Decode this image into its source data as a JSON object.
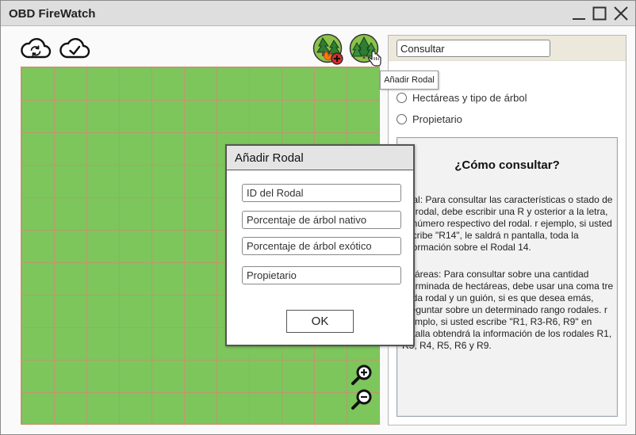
{
  "window": {
    "title": "OBD FireWatch"
  },
  "toolbar": {
    "sync_icon": "cloud-sync-icon",
    "saved_icon": "cloud-check-icon",
    "add_fire_icon": "tree-fire-add-icon",
    "add_stand_icon": "forest-add-icon",
    "tooltip": "Añadir Rodal"
  },
  "map": {
    "zoom_in_icon": "zoom-in-icon",
    "zoom_out_icon": "zoom-out-icon",
    "fill_color": "#7cc65c",
    "grid_color": "#c49470"
  },
  "panel": {
    "search_value": "Consultar",
    "options": [
      {
        "label": "Hectáreas y tipo de árbol"
      },
      {
        "label": "Propietario"
      }
    ],
    "help": {
      "title": "¿Cómo consultar?",
      "para1": "odal: Para consultar las características o stado de un rodal, debe escribir una R y osterior a la letra, el número respectivo del rodal. r ejemplo, si usted escribe \"R14\", le saldrá n pantalla, toda la información sobre el Rodal 14.",
      "para2": "ectáreas: Para consultar sobre una cantidad eterminada de hectáreas, debe usar una coma tre cada rodal y un guión, si es que desea emás, preguntar sobre un determinado rango rodales. r ejemplo, si usted escribe  \"R1, R3-R6, R9\" en antalla obtendrá la información de los rodales R1, R3, R4, R5, R6 y R9."
    }
  },
  "dialog": {
    "title": "Añadir Rodal",
    "fields": [
      {
        "placeholder": "ID del Rodal"
      },
      {
        "placeholder": "Porcentaje de árbol nativo"
      },
      {
        "placeholder": "Porcentaje de árbol exótico"
      },
      {
        "placeholder": "Propietario"
      }
    ],
    "ok_label": "OK"
  }
}
